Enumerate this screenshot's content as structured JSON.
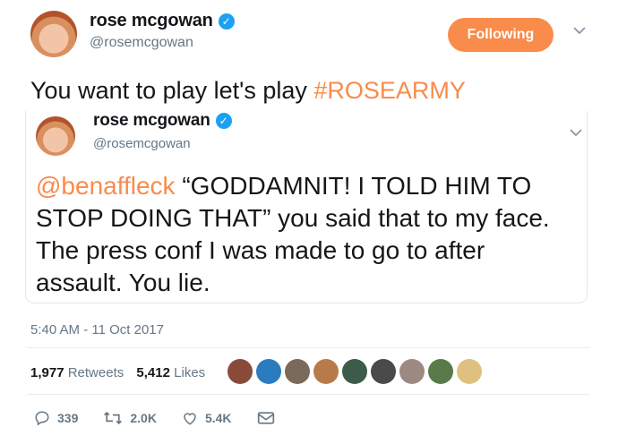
{
  "author": {
    "name": "rose mcgowan",
    "handle": "@rosemcgowan"
  },
  "follow_button": {
    "label": "Following"
  },
  "tweet": {
    "text_prefix": "You want to play let's play ",
    "hashtag": "#ROSEARMY"
  },
  "quoted": {
    "name": "rose mcgowan",
    "handle": "@rosemcgowan",
    "mention": "@benaffleck",
    "body": " “GODDAMNIT! I TOLD HIM TO STOP DOING THAT” you said that to my face. The press conf I was made to go to after assault. You lie."
  },
  "timestamp": "5:40 AM - 11 Oct 2017",
  "stats": {
    "retweets_count": "1,977",
    "retweets_label": "Retweets",
    "likes_count": "5,412",
    "likes_label": "Likes"
  },
  "likers": [
    {
      "name": "liker-avatar-1",
      "color": "#8a4a3a"
    },
    {
      "name": "liker-avatar-2",
      "color": "#2b7bbf"
    },
    {
      "name": "liker-avatar-3",
      "color": "#7a6a5a"
    },
    {
      "name": "liker-avatar-4",
      "color": "#b97a4a"
    },
    {
      "name": "liker-avatar-5",
      "color": "#3d5b4a"
    },
    {
      "name": "liker-avatar-6",
      "color": "#4a4a4a"
    },
    {
      "name": "liker-avatar-7",
      "color": "#9c8a82"
    },
    {
      "name": "liker-avatar-8",
      "color": "#5a7a4a"
    },
    {
      "name": "liker-avatar-9",
      "color": "#e0c080"
    }
  ],
  "actions": {
    "reply_count": "339",
    "retweet_count": "2.0K",
    "like_count": "5.4K"
  }
}
